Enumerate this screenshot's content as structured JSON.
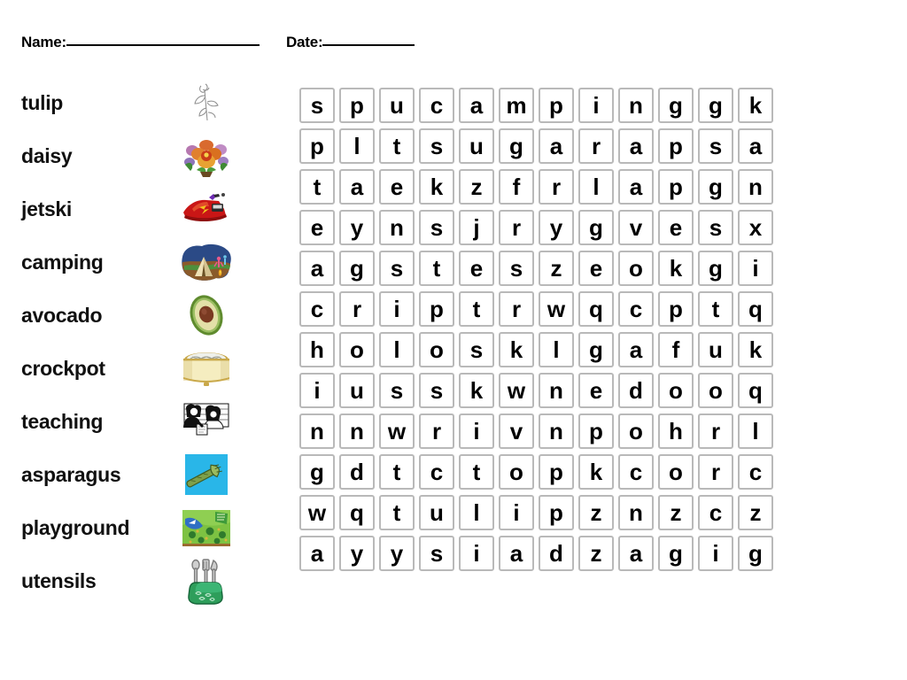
{
  "header": {
    "name_label": "Name:",
    "date_label": "Date:",
    "name_value": "",
    "date_value": ""
  },
  "word_list": [
    {
      "word": "tulip",
      "icon": "tulip-sketch-icon"
    },
    {
      "word": "daisy",
      "icon": "flower-bouquet-icon"
    },
    {
      "word": "jetski",
      "icon": "jetski-icon"
    },
    {
      "word": "camping",
      "icon": "campsite-tent-icon"
    },
    {
      "word": "avocado",
      "icon": "avocado-half-icon"
    },
    {
      "word": "crockpot",
      "icon": "crockpot-icon"
    },
    {
      "word": "teaching",
      "icon": "teacher-students-icon"
    },
    {
      "word": "asparagus",
      "icon": "asparagus-icon"
    },
    {
      "word": "playground",
      "icon": "playground-park-icon"
    },
    {
      "word": "utensils",
      "icon": "utensil-jar-icon"
    }
  ],
  "puzzle": {
    "rows": 12,
    "cols": 12,
    "grid": [
      [
        "s",
        "p",
        "u",
        "c",
        "a",
        "m",
        "p",
        "i",
        "n",
        "g",
        "g",
        "k"
      ],
      [
        "p",
        "l",
        "t",
        "s",
        "u",
        "g",
        "a",
        "r",
        "a",
        "p",
        "s",
        "a"
      ],
      [
        "t",
        "a",
        "e",
        "k",
        "z",
        "f",
        "r",
        "l",
        "a",
        "p",
        "g",
        "n"
      ],
      [
        "e",
        "y",
        "n",
        "s",
        "j",
        "r",
        "y",
        "g",
        "v",
        "e",
        "s",
        "x"
      ],
      [
        "a",
        "g",
        "s",
        "t",
        "e",
        "s",
        "z",
        "e",
        "o",
        "k",
        "g",
        "i"
      ],
      [
        "c",
        "r",
        "i",
        "p",
        "t",
        "r",
        "w",
        "q",
        "c",
        "p",
        "t",
        "q"
      ],
      [
        "h",
        "o",
        "l",
        "o",
        "s",
        "k",
        "l",
        "g",
        "a",
        "f",
        "u",
        "k"
      ],
      [
        "i",
        "u",
        "s",
        "s",
        "k",
        "w",
        "n",
        "e",
        "d",
        "o",
        "o",
        "q"
      ],
      [
        "n",
        "n",
        "w",
        "r",
        "i",
        "v",
        "n",
        "p",
        "o",
        "h",
        "r",
        "l"
      ],
      [
        "g",
        "d",
        "t",
        "c",
        "t",
        "o",
        "p",
        "k",
        "c",
        "o",
        "r",
        "c"
      ],
      [
        "w",
        "q",
        "t",
        "u",
        "l",
        "i",
        "p",
        "z",
        "n",
        "z",
        "c",
        "z"
      ],
      [
        "a",
        "y",
        "y",
        "s",
        "i",
        "a",
        "d",
        "z",
        "a",
        "g",
        "i",
        "g"
      ]
    ]
  },
  "colors": {
    "cell_border": "#b9b9b9",
    "text": "#000000",
    "background": "#ffffff",
    "asparagus_bg": "#29b6e8",
    "playground_green": "#7dc242",
    "jetski_red": "#c91616",
    "avocado_green": "#9fc16a",
    "utensil_green": "#2e9e5b"
  }
}
